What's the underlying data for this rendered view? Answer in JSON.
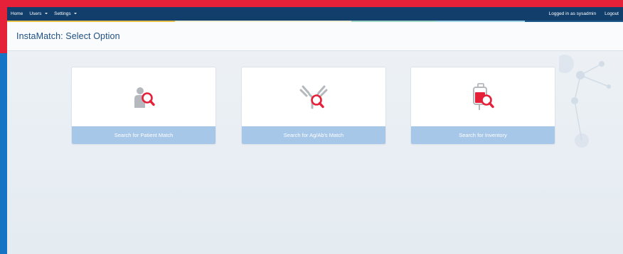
{
  "nav": {
    "home": "Home",
    "users": "Users",
    "settings": "Settings",
    "logged_in": "Logged in as sysadmin",
    "logout": "Logout"
  },
  "page": {
    "title": "InstaMatch: Select Option"
  },
  "cards": [
    {
      "label": "Search for Patient Match",
      "icon": "patient-search-icon"
    },
    {
      "label": "Search for Ag/Ab's Match",
      "icon": "antibody-search-icon"
    },
    {
      "label": "Search for Inventory",
      "icon": "blood-bag-search-icon"
    }
  ],
  "colors": {
    "navbar": "#123e6b",
    "accent_red": "#e5213a",
    "accent_blue": "#1574c4",
    "card_label_bg": "#a7c7e9",
    "title": "#1e4f82",
    "icon_gray": "#b5b9bd",
    "icon_red": "#e5213a"
  },
  "stripe_colors": [
    "#e7c24a",
    "#e9ecd2",
    "#9fd4c8",
    "#9ed2e8",
    "#1f5c8c"
  ]
}
